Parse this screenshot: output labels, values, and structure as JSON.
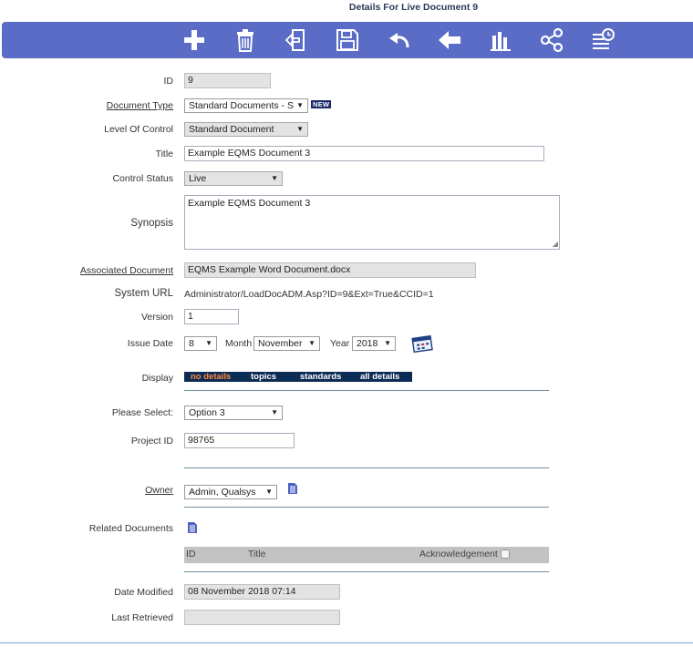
{
  "page_title": "Details For Live Document 9",
  "toolbar": {
    "buttons": [
      {
        "icon": "add-icon"
      },
      {
        "icon": "trash-icon"
      },
      {
        "icon": "checkout-icon"
      },
      {
        "icon": "save-icon"
      },
      {
        "icon": "undo-icon"
      },
      {
        "icon": "back-arrow-icon"
      },
      {
        "icon": "bar-chart-icon"
      },
      {
        "icon": "share-icon"
      },
      {
        "icon": "history-list-icon"
      }
    ],
    "color": "#5a6cc5"
  },
  "form": {
    "id": {
      "label": "ID",
      "value": "9"
    },
    "document_type": {
      "label": "Document Type",
      "value": "Standard Documents - S",
      "badge": "NEW"
    },
    "level_of_control": {
      "label": "Level Of Control",
      "value": "Standard Document"
    },
    "title": {
      "label": "Title",
      "value": "Example EQMS Document 3"
    },
    "control_status": {
      "label": "Control Status",
      "value": "Live"
    },
    "synopsis": {
      "label": "Synopsis",
      "value": "Example EQMS Document 3"
    },
    "associated_document": {
      "label": "Associated Document",
      "value": "EQMS Example Word Document.docx"
    },
    "system_url": {
      "label": "System URL",
      "value": "Administrator/LoadDocADM.Asp?ID=9&Ext=True&CCID=1"
    },
    "version": {
      "label": "Version",
      "value": "1"
    },
    "issue_date": {
      "label": "Issue Date",
      "day": "8",
      "month_label": "Month",
      "month": "November",
      "year_label": "Year",
      "year": "2018"
    },
    "display": {
      "label": "Display",
      "tabs": [
        "no details",
        "topics",
        "standards",
        "all details"
      ],
      "active": "no details"
    },
    "please_select": {
      "label": "Please Select:",
      "value": "Option 3"
    },
    "project_id": {
      "label": "Project ID",
      "value": "98765"
    },
    "owner": {
      "label": "Owner",
      "value": "Admin, Qualsys"
    },
    "related_documents": {
      "label": "Related Documents",
      "columns": [
        "ID",
        "Title",
        "Acknowledgement"
      ]
    },
    "date_modified": {
      "label": "Date Modified",
      "value": "08 November 2018 07:14"
    },
    "last_retrieved": {
      "label": "Last Retrieved",
      "value": ""
    }
  }
}
